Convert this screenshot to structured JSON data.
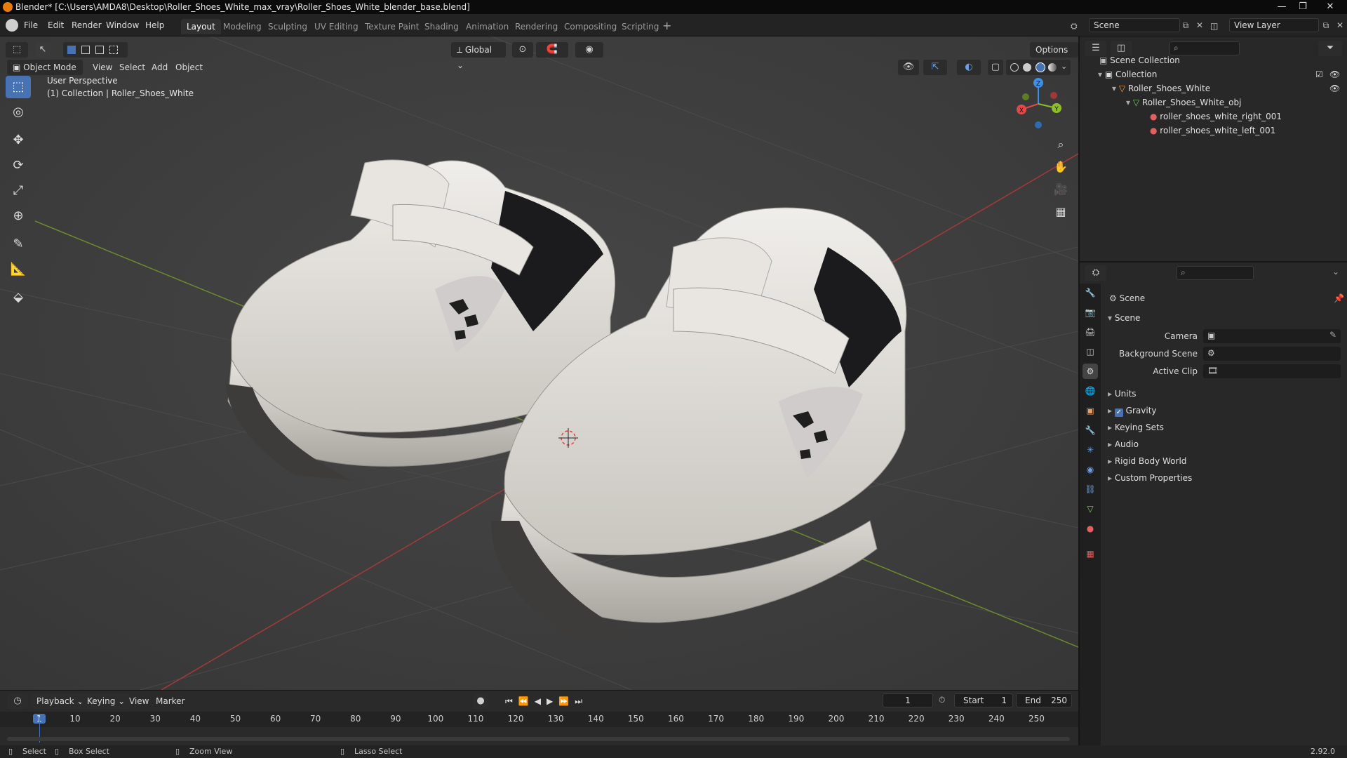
{
  "titlebar": {
    "title": "Blender* [C:\\Users\\AMDA8\\Desktop\\Roller_Shoes_White_max_vray\\Roller_Shoes_White_blender_base.blend]"
  },
  "menus": [
    "File",
    "Edit",
    "Render",
    "Window",
    "Help"
  ],
  "workspaces": [
    "Layout",
    "Modeling",
    "Sculpting",
    "UV Editing",
    "Texture Paint",
    "Shading",
    "Animation",
    "Rendering",
    "Compositing",
    "Scripting"
  ],
  "scene_field": "Scene",
  "view_layer_field": "View Layer",
  "viewport": {
    "transform_orientation": "Global",
    "options_label": "Options",
    "mode": "Object Mode",
    "header_menus": [
      "View",
      "Select",
      "Add",
      "Object"
    ],
    "overlay_line1": "User Perspective",
    "overlay_line2": "(1) Collection | Roller_Shoes_White",
    "gizmo": {
      "x": "X",
      "y": "Y",
      "z": "Z"
    }
  },
  "outliner": {
    "rows": [
      "Scene Collection",
      "Collection",
      "Roller_Shoes_White",
      "Roller_Shoes_White_obj",
      "roller_shoes_white_right_001",
      "roller_shoes_white_left_001"
    ]
  },
  "properties": {
    "header": "Scene",
    "panel": "Scene",
    "camera_label": "Camera",
    "bg_scene_label": "Background Scene",
    "active_clip_label": "Active Clip",
    "sections": [
      "Units",
      "Gravity",
      "Keying Sets",
      "Audio",
      "Rigid Body World",
      "Custom Properties"
    ],
    "gravity_checked": true
  },
  "timeline": {
    "menus": [
      "Playback",
      "Keying",
      "View",
      "Marker"
    ],
    "current_frame": "1",
    "start_label": "Start",
    "start_value": "1",
    "end_label": "End",
    "end_value": "250",
    "ticks": [
      "1",
      "10",
      "20",
      "30",
      "40",
      "50",
      "60",
      "70",
      "80",
      "90",
      "100",
      "110",
      "120",
      "130",
      "140",
      "150",
      "160",
      "170",
      "180",
      "190",
      "200",
      "210",
      "220",
      "230",
      "240",
      "250"
    ]
  },
  "statusbar": {
    "select": "Select",
    "box_select": "Box Select",
    "zoom_view": "Zoom View",
    "lasso_select": "Lasso Select",
    "version": "2.92.0"
  },
  "colors": {
    "accent": "#4772b3",
    "x_axis": "#e24a4a",
    "y_axis": "#8cbf26",
    "z_axis": "#3f8fe6",
    "brand": "#e87d0d"
  }
}
